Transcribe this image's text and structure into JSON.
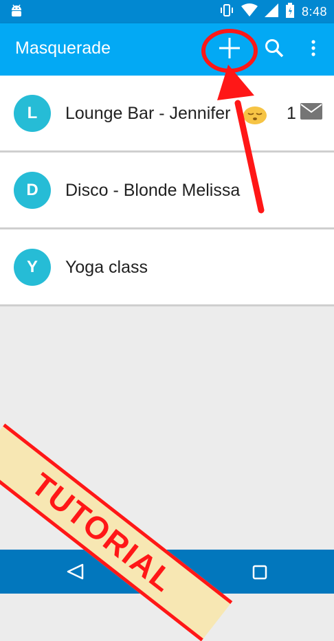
{
  "status_bar": {
    "time": "8:48"
  },
  "app_bar": {
    "title": "Masquerade",
    "actions": [
      {
        "name": "add",
        "icon": "plus-icon"
      },
      {
        "name": "search",
        "icon": "search-icon"
      },
      {
        "name": "overflow",
        "icon": "more-vert-icon"
      }
    ]
  },
  "conversations": [
    {
      "initial": "L",
      "title": "Lounge Bar - Jennifer",
      "unread_count": "1",
      "emoji": "sleeping-face",
      "unread_icon": "mail-icon"
    },
    {
      "initial": "D",
      "title": "Disco - Blonde Melissa"
    },
    {
      "initial": "Y",
      "title": "Yoga class"
    }
  ],
  "tutorial_banner": {
    "text": "TUTORIAL"
  },
  "colors": {
    "status_bar": "#0288d1",
    "app_bar": "#03a9f4",
    "avatar": "#26bcd6",
    "nav_bar": "#0277bd",
    "annotation_red": "#ff1717",
    "banner_bg": "#f7e7b3"
  }
}
